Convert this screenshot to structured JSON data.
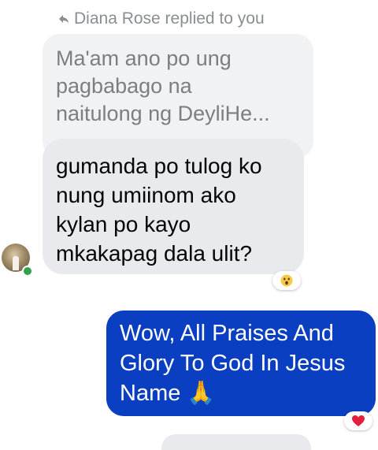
{
  "reply_header": {
    "icon": "reply-arrow-icon",
    "text": "Diana Rose replied to you"
  },
  "quoted_message": {
    "lines": [
      "Ma'am ano po ung",
      "pagbabago na",
      "naitulong ng DeyliHe..."
    ]
  },
  "incoming_message": {
    "lines": [
      "gumanda po tulog ko",
      "nung umiinom ako",
      "kylan po kayo",
      "mkakapag dala ulit?"
    ],
    "reaction": "😮",
    "reaction_icon": "wow-emoji-icon"
  },
  "sender": {
    "avatar_icon": "avatar",
    "online": true,
    "online_color": "#31a24c"
  },
  "outgoing_message": {
    "lines": [
      "Wow, All Praises And",
      "Glory To God In Jesus",
      "Name 🙏"
    ],
    "bubble_color": "#0b3fc1",
    "reaction_icon": "heart-icon",
    "reaction_color": "#e41e3f"
  }
}
